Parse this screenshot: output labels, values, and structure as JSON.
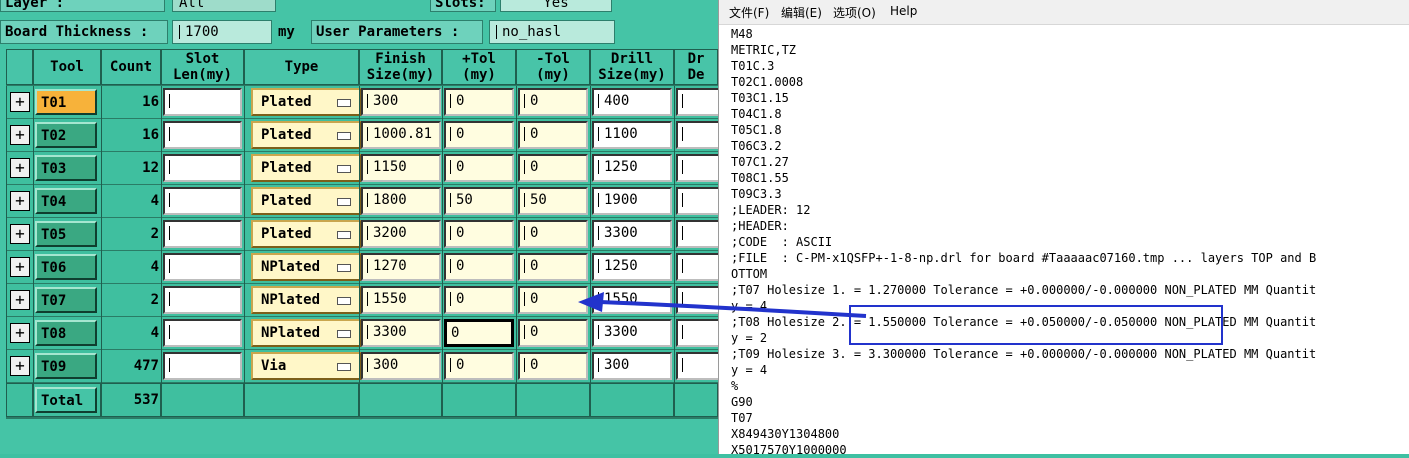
{
  "header": {
    "layer_label": "Layer    :",
    "layer_value": "All",
    "slots_label": "Slots:",
    "slots_value": "Yes",
    "board_thickness_label": "Board Thickness :",
    "board_thickness_value": "1700",
    "board_thickness_unit": "my",
    "user_params_label": "User Parameters :",
    "user_params_value": "no_hasl"
  },
  "columns": [
    "Tool",
    "Count",
    "Slot\nLen(my)",
    "Type",
    "Finish\nSize(my)",
    "+Tol\n(my)",
    "-Tol\n(my)",
    "Drill\nSize(my)",
    "Dr\nDe"
  ],
  "rows": [
    {
      "tool": "T01",
      "count": "16",
      "type": "Plated",
      "finish": "300",
      "ptol": "0",
      "ntol": "0",
      "drill": "400",
      "selected": true
    },
    {
      "tool": "T02",
      "count": "16",
      "type": "Plated",
      "finish": "1000.81",
      "ptol": "0",
      "ntol": "0",
      "drill": "1100"
    },
    {
      "tool": "T03",
      "count": "12",
      "type": "Plated",
      "finish": "1150",
      "ptol": "0",
      "ntol": "0",
      "drill": "1250"
    },
    {
      "tool": "T04",
      "count": "4",
      "type": "Plated",
      "finish": "1800",
      "ptol": "50",
      "ntol": "50",
      "drill": "1900"
    },
    {
      "tool": "T05",
      "count": "2",
      "type": "Plated",
      "finish": "3200",
      "ptol": "0",
      "ntol": "0",
      "drill": "3300"
    },
    {
      "tool": "T06",
      "count": "4",
      "type": "NPlated",
      "finish": "1270",
      "ptol": "0",
      "ntol": "0",
      "drill": "1250"
    },
    {
      "tool": "T07",
      "count": "2",
      "type": "NPlated",
      "finish": "1550",
      "ptol": "0",
      "ntol": "0",
      "drill": "1550"
    },
    {
      "tool": "T08",
      "count": "4",
      "type": "NPlated",
      "finish": "3300",
      "ptol": "0",
      "ntol": "0",
      "drill": "3300",
      "focus": true
    },
    {
      "tool": "T09",
      "count": "477",
      "type": "Via",
      "finish": "300",
      "ptol": "0",
      "ntol": "0",
      "drill": "300"
    }
  ],
  "total": {
    "label": "Total",
    "count": "537"
  },
  "notepad": {
    "menu": [
      "文件(F)",
      "编辑(E)",
      "选项(O)",
      "Help"
    ],
    "lines": [
      "M48",
      "METRIC,TZ",
      "T01C.3",
      "T02C1.0008",
      "T03C1.15",
      "T04C1.8",
      "T05C1.8",
      "T06C3.2",
      "T07C1.27",
      "T08C1.55",
      "T09C3.3",
      ";LEADER: 12",
      ";HEADER:",
      ";CODE  : ASCII",
      ";FILE  : C-PM-x1QSFP+-1-8-np.drl for board #Taaaaac07160.tmp ... layers TOP and B",
      "OTTOM",
      ";T07 Holesize 1. = 1.270000 Tolerance = +0.000000/-0.000000 NON_PLATED MM Quantit",
      "y = 4",
      ";T08 Holesize 2. = 1.550000 Tolerance = +0.050000/-0.050000 NON_PLATED MM Quantit",
      "y = 2",
      ";T09 Holesize 3. = 3.300000 Tolerance = +0.000000/-0.000000 NON_PLATED MM Quantit",
      "y = 4",
      "%",
      "G90",
      "T07",
      "X849430Y1304800",
      "X5017570Y1000000"
    ]
  },
  "colors": {
    "accent_blue": "#2233cc",
    "selected_tool": "#f7b23a",
    "panel_green": "#45c4a6"
  }
}
